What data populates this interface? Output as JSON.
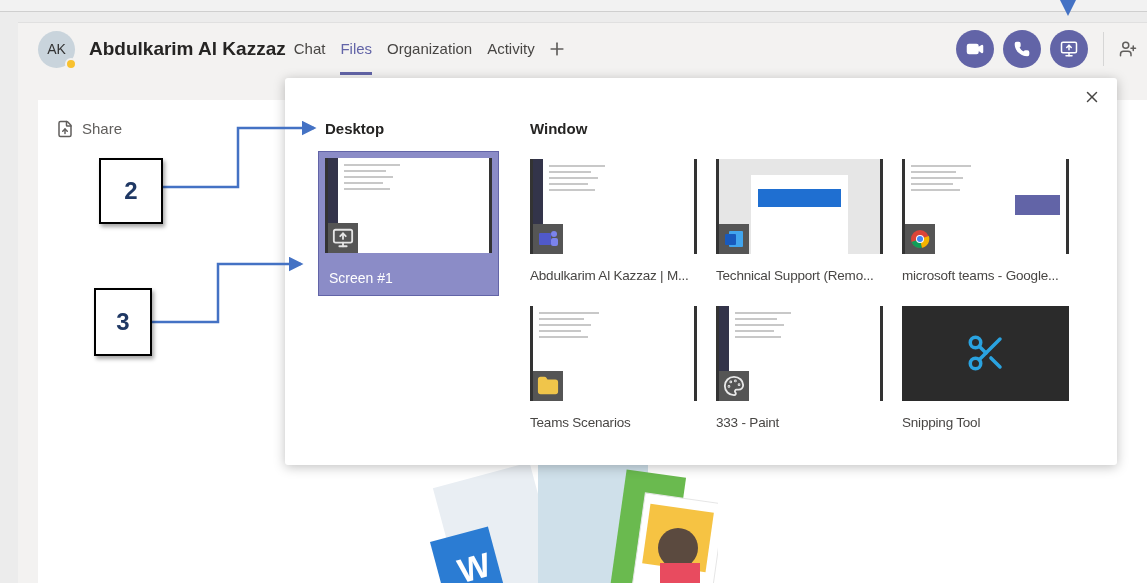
{
  "header": {
    "avatar": "AK",
    "name": "Abdulkarim Al Kazzaz",
    "tabs": [
      {
        "label": "Chat",
        "selected": false
      },
      {
        "label": "Files",
        "selected": true
      },
      {
        "label": "Organization",
        "selected": false
      },
      {
        "label": "Activity",
        "selected": false
      }
    ]
  },
  "share": {
    "label": "Share"
  },
  "popup": {
    "desktop": {
      "title": "Desktop",
      "screens": [
        {
          "label": "Screen #1",
          "selected": true
        }
      ]
    },
    "window": {
      "title": "Window",
      "windows": [
        {
          "label": "Abdulkarim Al Kazzaz | M...",
          "kind": "teams"
        },
        {
          "label": "Technical Support (Remo...",
          "kind": "word"
        },
        {
          "label": "microsoft teams - Google...",
          "kind": "chrome"
        },
        {
          "label": "Teams Scenarios",
          "kind": "explorer"
        },
        {
          "label": "333 - Paint",
          "kind": "paint"
        },
        {
          "label": "Snipping Tool",
          "kind": "snipping"
        }
      ]
    }
  },
  "illustration": {
    "logo_letter": "W"
  },
  "callouts": [
    {
      "label": "2"
    },
    {
      "label": "3"
    }
  ]
}
